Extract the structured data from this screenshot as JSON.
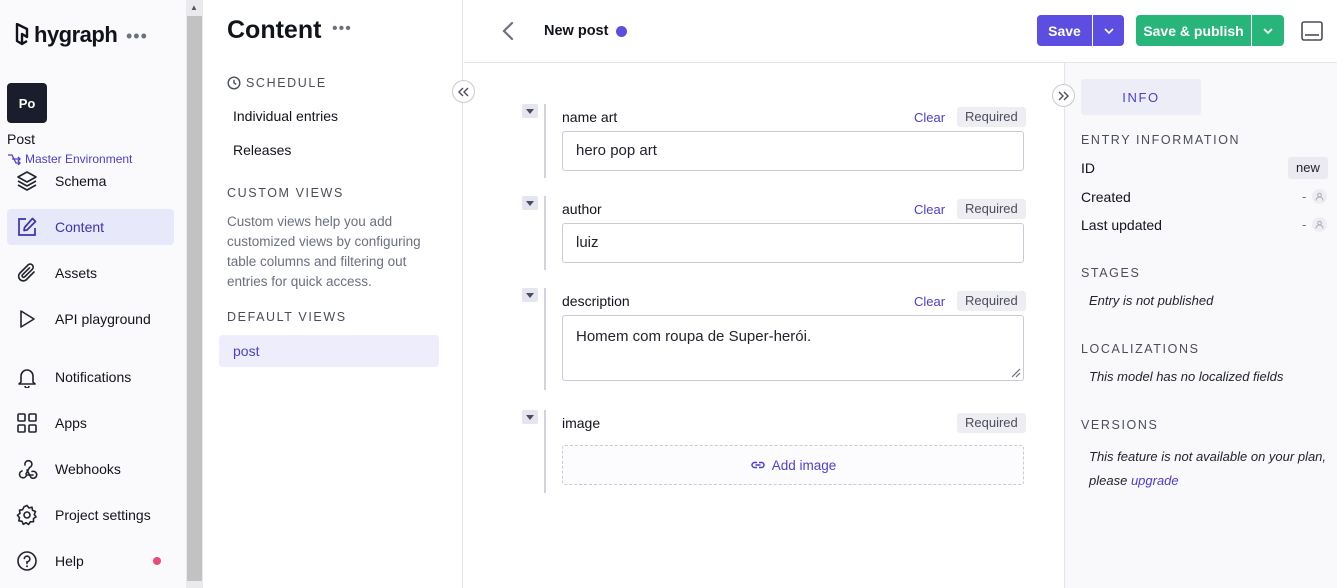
{
  "brand": {
    "name": "hygraph",
    "menu_dots": "•••"
  },
  "project": {
    "avatar_initials": "Po",
    "name": "Post",
    "environment": "Master Environment"
  },
  "nav": {
    "items": [
      {
        "label": "Schema",
        "icon": "layers-icon"
      },
      {
        "label": "Content",
        "icon": "edit-icon",
        "active": true
      },
      {
        "label": "Assets",
        "icon": "paperclip-icon"
      },
      {
        "label": "API playground",
        "icon": "play-icon"
      },
      {
        "label": "Notifications",
        "icon": "bell-icon"
      },
      {
        "label": "Apps",
        "icon": "apps-grid-icon"
      },
      {
        "label": "Webhooks",
        "icon": "webhook-icon"
      },
      {
        "label": "Project settings",
        "icon": "gear-icon"
      },
      {
        "label": "Help",
        "icon": "help-circle-icon",
        "has_notification": true
      }
    ]
  },
  "content_panel": {
    "title": "Content",
    "menu_dots": "•••",
    "schedule_heading": "SCHEDULE",
    "schedule_links": [
      "Individual entries",
      "Releases"
    ],
    "custom_views_heading": "CUSTOM VIEWS",
    "custom_views_description": "Custom views help you add customized views by configuring table columns and filtering out entries for quick access.",
    "default_views_heading": "DEFAULT VIEWS",
    "default_view": "post"
  },
  "header": {
    "entry_title": "New post",
    "save_label": "Save",
    "save_publish_label": "Save & publish"
  },
  "fields": [
    {
      "label": "name art",
      "clear": "Clear",
      "required": "Required",
      "value": "hero pop art"
    },
    {
      "label": "author",
      "clear": "Clear",
      "required": "Required",
      "value": "luiz"
    },
    {
      "label": "description",
      "clear": "Clear",
      "required": "Required",
      "value": "Homem com roupa de Super-herói."
    },
    {
      "label": "image",
      "required": "Required",
      "action": "Add image"
    }
  ],
  "sidebar": {
    "tab": "INFO",
    "entry_info_heading": "ENTRY INFORMATION",
    "id_label": "ID",
    "id_value": "new",
    "created_label": "Created",
    "created_value": "-",
    "updated_label": "Last updated",
    "updated_value": "-",
    "stages_heading": "STAGES",
    "stages_text": "Entry is not published",
    "localizations_heading": "LOCALIZATIONS",
    "localizations_text": "This model has no localized fields",
    "versions_heading": "VERSIONS",
    "versions_text_1": "This feature is not available on your plan,",
    "versions_text_2": "please",
    "versions_link": "upgrade"
  },
  "colors": {
    "primary": "#5b4ee0",
    "publish": "#28b57a",
    "notification": "#ec4b78"
  }
}
